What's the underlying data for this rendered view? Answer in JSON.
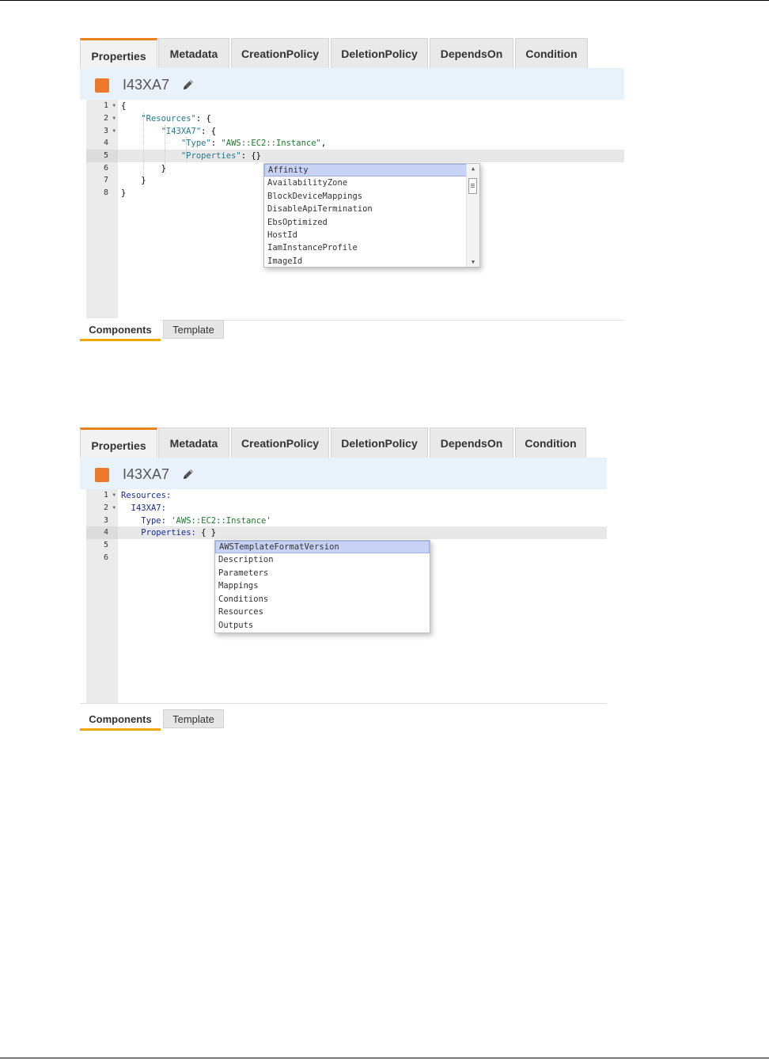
{
  "panels": [
    {
      "tabs": [
        "Properties",
        "Metadata",
        "CreationPolicy",
        "DeletionPolicy",
        "DependsOn",
        "Condition"
      ],
      "resource_name": "I43XA7",
      "gutter": [
        "1",
        "2",
        "3",
        "4",
        "5",
        "6",
        "7",
        "8"
      ],
      "code": [
        [
          {
            "t": "{",
            "c": "pun"
          }
        ],
        [
          {
            "t": "    ",
            "c": "pun"
          },
          {
            "t": "\"Resources\"",
            "c": "key"
          },
          {
            "t": ": {",
            "c": "pun"
          }
        ],
        [
          {
            "t": "        ",
            "c": "pun"
          },
          {
            "t": "\"I43XA7\"",
            "c": "key"
          },
          {
            "t": ": {",
            "c": "pun"
          }
        ],
        [
          {
            "t": "            ",
            "c": "pun"
          },
          {
            "t": "\"Type\"",
            "c": "key"
          },
          {
            "t": ": ",
            "c": "pun"
          },
          {
            "t": "\"AWS::EC2::Instance\"",
            "c": "str"
          },
          {
            "t": ",",
            "c": "pun"
          }
        ],
        [
          {
            "t": "            ",
            "c": "pun"
          },
          {
            "t": "\"Properties\"",
            "c": "key"
          },
          {
            "t": ": {}",
            "c": "pun"
          }
        ],
        [
          {
            "t": "        }",
            "c": "pun"
          }
        ],
        [
          {
            "t": "    }",
            "c": "pun"
          }
        ],
        [
          {
            "t": "}",
            "c": "pun"
          }
        ]
      ],
      "autocomplete": [
        "Affinity",
        "AvailabilityZone",
        "BlockDeviceMappings",
        "DisableApiTermination",
        "EbsOptimized",
        "HostId",
        "IamInstanceProfile",
        "ImageId"
      ],
      "bottom_tabs": [
        "Components",
        "Template"
      ]
    },
    {
      "tabs": [
        "Properties",
        "Metadata",
        "CreationPolicy",
        "DeletionPolicy",
        "DependsOn",
        "Condition"
      ],
      "resource_name": "I43XA7",
      "gutter": [
        "1",
        "2",
        "3",
        "4",
        "5",
        "6"
      ],
      "code": [
        [
          {
            "t": "Resources:",
            "c": "yk"
          }
        ],
        [
          {
            "t": "  ",
            "c": "pun"
          },
          {
            "t": "I43XA7:",
            "c": "yk"
          }
        ],
        [
          {
            "t": "    ",
            "c": "pun"
          },
          {
            "t": "Type:",
            "c": "yk"
          },
          {
            "t": " ",
            "c": "pun"
          },
          {
            "t": "'AWS::EC2::Instance'",
            "c": "ys"
          }
        ],
        [
          {
            "t": "    ",
            "c": "pun"
          },
          {
            "t": "Properties:",
            "c": "yk"
          },
          {
            "t": " { }",
            "c": "pun"
          }
        ],
        [],
        []
      ],
      "autocomplete": [
        "AWSTemplateFormatVersion",
        "Description",
        "Parameters",
        "Mappings",
        "Conditions",
        "Resources",
        "Outputs"
      ],
      "bottom_tabs": [
        "Components",
        "Template"
      ]
    }
  ]
}
